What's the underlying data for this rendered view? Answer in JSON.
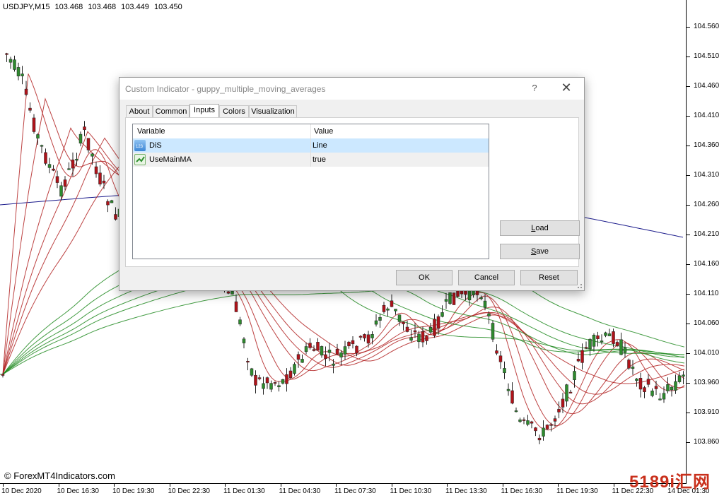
{
  "chart": {
    "symbol": "USDJPY,M15",
    "ohlc": [
      "103.468",
      "103.468",
      "103.449",
      "103.450"
    ],
    "price_labels": [
      "104.560",
      "104.510",
      "104.460",
      "104.410",
      "104.360",
      "104.310",
      "104.260",
      "104.210",
      "104.160",
      "104.110",
      "104.060",
      "104.010",
      "103.960",
      "103.910",
      "103.860"
    ],
    "time_labels": [
      "10 Dec 2020",
      "10 Dec 16:30",
      "10 Dec 19:30",
      "10 Dec 22:30",
      "11 Dec 01:30",
      "11 Dec 04:30",
      "11 Dec 07:30",
      "11 Dec 10:30",
      "11 Dec 13:30",
      "11 Dec 16:30",
      "11 Dec 19:30",
      "11 Dec 22:30",
      "14 Dec 01:30"
    ],
    "copyright": "© ForexMT4Indicators.com",
    "watermark": "5189i汇网",
    "colors": {
      "bull": "#2e8b2e",
      "bear": "#b0131a",
      "short_ma": "#b22222",
      "long_ma": "#228b22",
      "slow_ma": "#1c1c8c"
    }
  },
  "dialog": {
    "title": "Custom Indicator - guppy_multiple_moving_averages",
    "help": "?",
    "close": "✕",
    "tabs": [
      "About",
      "Common",
      "Inputs",
      "Colors",
      "Visualization"
    ],
    "active_tab": "Inputs",
    "table": {
      "headers": [
        "Variable",
        "Value"
      ],
      "rows": [
        {
          "icon": "numeric-icon",
          "variable": "DiS",
          "value": "Line"
        },
        {
          "icon": "bool-icon",
          "variable": "UseMainMA",
          "value": "true"
        }
      ]
    },
    "buttons": {
      "load": "Load",
      "save": "Save",
      "ok": "OK",
      "cancel": "Cancel",
      "reset": "Reset"
    }
  }
}
